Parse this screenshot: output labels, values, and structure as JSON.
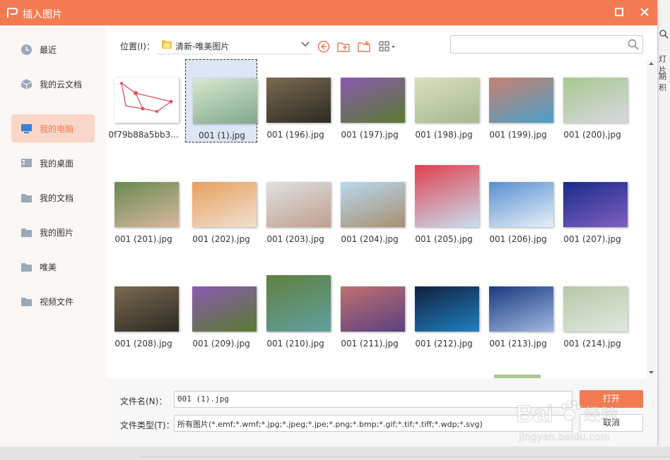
{
  "background": {
    "right_text_1": "灯片",
    "right_text_2": "期积"
  },
  "dialog": {
    "title": "插入图片",
    "accent_color": "#f37b54"
  },
  "sidebar": {
    "items": [
      {
        "label": "最近",
        "icon": "clock-icon",
        "active": false
      },
      {
        "label": "我的云文档",
        "icon": "cloud-cube-icon",
        "active": false
      },
      {
        "label": "我的电脑",
        "icon": "monitor-icon",
        "active": true
      },
      {
        "label": "我的桌面",
        "icon": "desktop-icon",
        "active": false
      },
      {
        "label": "我的文档",
        "icon": "folder-icon",
        "active": false
      },
      {
        "label": "我的图片",
        "icon": "folder-icon",
        "active": false
      },
      {
        "label": "唯美",
        "icon": "folder-icon",
        "active": false
      },
      {
        "label": "视频文件",
        "icon": "folder-icon",
        "active": false
      }
    ]
  },
  "toolbar": {
    "location_label": "位置(I)：",
    "location_value": "清新-唯美图片",
    "search_placeholder": ""
  },
  "files": [
    {
      "name": "0f79b88a5bb3...",
      "colors": [
        "#ffffff",
        "#ffffff"
      ],
      "h": 64,
      "selected": false
    },
    {
      "name": "001 (1).jpg",
      "colors": [
        "#d8e8d0",
        "#7fa88a"
      ],
      "h": 64,
      "selected": true
    },
    {
      "name": "001 (196).jpg",
      "colors": [
        "#7a6a52",
        "#2d2a22"
      ],
      "h": 64,
      "selected": false
    },
    {
      "name": "001 (197).jpg",
      "colors": [
        "#8a5ab0",
        "#5a7a30"
      ],
      "h": 64,
      "selected": false
    },
    {
      "name": "001 (198).jpg",
      "colors": [
        "#d8e0c0",
        "#a8b890"
      ],
      "h": 64,
      "selected": false
    },
    {
      "name": "001 (199).jpg",
      "colors": [
        "#c88070",
        "#4aa0c8"
      ],
      "h": 64,
      "selected": false
    },
    {
      "name": "001 (200).jpg",
      "colors": [
        "#a8c890",
        "#d8d8e0"
      ],
      "h": 64,
      "selected": false
    },
    {
      "name": "001 (201).jpg",
      "colors": [
        "#6a8a50",
        "#d8b8a0"
      ],
      "h": 64,
      "selected": false
    },
    {
      "name": "001 (202).jpg",
      "colors": [
        "#e8a060",
        "#f0e0d0"
      ],
      "h": 64,
      "selected": false
    },
    {
      "name": "001 (203).jpg",
      "colors": [
        "#e0e0e0",
        "#c0a090"
      ],
      "h": 64,
      "selected": false
    },
    {
      "name": "001 (204).jpg",
      "colors": [
        "#b8d8f0",
        "#a89070"
      ],
      "h": 64,
      "selected": false
    },
    {
      "name": "001 (205).jpg",
      "colors": [
        "#e04050",
        "#c8e0f0"
      ],
      "h": 88,
      "selected": false
    },
    {
      "name": "001 (206).jpg",
      "colors": [
        "#5890d0",
        "#e8f0f8"
      ],
      "h": 64,
      "selected": false
    },
    {
      "name": "001 (207).jpg",
      "colors": [
        "#1a2a8a",
        "#8060c0"
      ],
      "h": 64,
      "selected": false
    },
    {
      "name": "001 (208).jpg",
      "colors": [
        "#7a6a52",
        "#2d2a22"
      ],
      "h": 64,
      "selected": false
    },
    {
      "name": "001 (209).jpg",
      "colors": [
        "#8a5ab0",
        "#5a7a30"
      ],
      "h": 64,
      "selected": false
    },
    {
      "name": "001 (210).jpg",
      "colors": [
        "#608040",
        "#60a0a0"
      ],
      "h": 80,
      "selected": false
    },
    {
      "name": "001 (211).jpg",
      "colors": [
        "#c07070",
        "#5a4080"
      ],
      "h": 64,
      "selected": false
    },
    {
      "name": "001 (212).jpg",
      "colors": [
        "#102040",
        "#2080c0"
      ],
      "h": 64,
      "selected": false
    },
    {
      "name": "001 (213).jpg",
      "colors": [
        "#1a3a80",
        "#a0b8e0"
      ],
      "h": 64,
      "selected": false
    },
    {
      "name": "001 (214).jpg",
      "colors": [
        "#b8c8a8",
        "#e0e8e0"
      ],
      "h": 64,
      "selected": false
    }
  ],
  "footer": {
    "filename_label": "文件名(N)：",
    "filename_value": "001 (1).jpg",
    "filetype_label": "文件类型(T)：",
    "filetype_value": "所有图片(*.emf;*.wmf;*.jpg;*.jpeg;*.jpe;*.png;*.bmp;*.gif;*.tif;*.tiff;*.wdp;*.svg)",
    "open_button": "打开",
    "cancel_button": "取消"
  },
  "watermark": {
    "brand": "Bai",
    "suffix": "经验",
    "url": "jingyan.baidu.com"
  }
}
